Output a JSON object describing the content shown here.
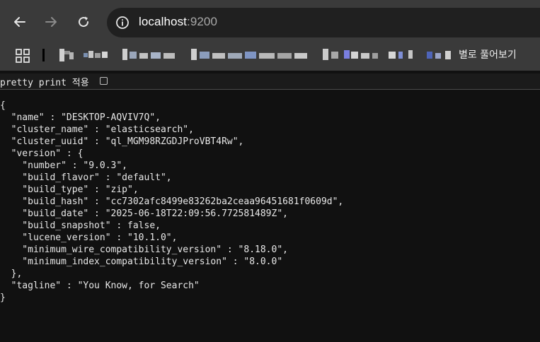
{
  "toolbar": {
    "back_icon": "arrow-left-icon",
    "forward_icon": "arrow-right-icon",
    "reload_icon": "reload-icon",
    "address": {
      "host": "localhost",
      "port": ":9200",
      "site_info_icon": "info-icon"
    }
  },
  "bookmarks": {
    "apps_icon": "apps-grid-icon",
    "more_label": "별로 풀어보기"
  },
  "pretty_print": {
    "label": "pretty print 적용",
    "checked": false
  },
  "json_lines": [
    "{",
    "  \"name\" : \"DESKTOP-AQVIV7Q\",",
    "  \"cluster_name\" : \"elasticsearch\",",
    "  \"cluster_uuid\" : \"ql_MGM98RZGDJProVBT4Rw\",",
    "  \"version\" : {",
    "    \"number\" : \"9.0.3\",",
    "    \"build_flavor\" : \"default\",",
    "    \"build_type\" : \"zip\",",
    "    \"build_hash\" : \"cc7302afc8499e83262ba2ceaa96451681f0609d\",",
    "    \"build_date\" : \"2025-06-18T22:09:56.772581489Z\",",
    "    \"build_snapshot\" : false,",
    "    \"lucene_version\" : \"10.1.0\",",
    "    \"minimum_wire_compatibility_version\" : \"8.18.0\",",
    "    \"minimum_index_compatibility_version\" : \"8.0.0\"",
    "  },",
    "  \"tagline\" : \"You Know, for Search\"",
    "}"
  ],
  "colors": {
    "page_bg": "#111111",
    "toolbar_bg": "#3a3a3a",
    "address_bg": "#202020",
    "text": "#e8e8e8"
  }
}
